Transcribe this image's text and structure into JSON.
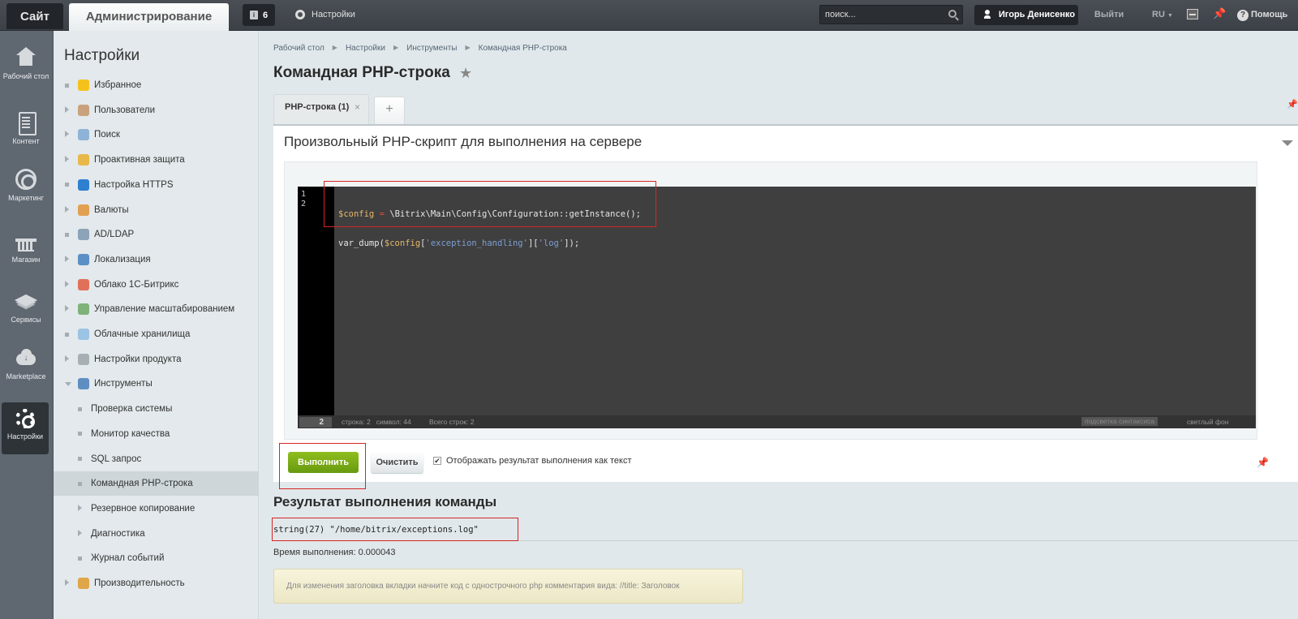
{
  "topbar": {
    "site_label": "Сайт",
    "admin_label": "Администрирование",
    "notifications_count": "6",
    "settings_label": "Настройки",
    "search_placeholder": "поиск...",
    "user_name": "Игорь Денисенко",
    "logout_label": "Выйти",
    "language": "RU",
    "help_label": "Помощь"
  },
  "leftnav": {
    "items": [
      {
        "label": "Рабочий стол",
        "icon": "home-icon"
      },
      {
        "label": "Контент",
        "icon": "document-icon"
      },
      {
        "label": "Маркетинг",
        "icon": "target-icon"
      },
      {
        "label": "Магазин",
        "icon": "basket-icon"
      },
      {
        "label": "Сервисы",
        "icon": "layers-icon"
      },
      {
        "label": "Marketplace",
        "icon": "cloud-download-icon"
      },
      {
        "label": "Настройки",
        "icon": "gear-icon",
        "active": true
      }
    ]
  },
  "sidemenu": {
    "title": "Настройки",
    "items": [
      {
        "label": "Избранное",
        "icon": "star-icon",
        "expandable": false
      },
      {
        "label": "Пользователи",
        "icon": "user-icon",
        "expandable": true
      },
      {
        "label": "Поиск",
        "icon": "magnifier-icon",
        "expandable": true
      },
      {
        "label": "Проактивная защита",
        "icon": "lock-icon",
        "expandable": true
      },
      {
        "label": "Настройка HTTPS",
        "icon": "https-lock-icon",
        "expandable": false
      },
      {
        "label": "Валюты",
        "icon": "currency-icon",
        "expandable": true
      },
      {
        "label": "AD/LDAP",
        "icon": "ldap-icon",
        "expandable": false
      },
      {
        "label": "Локализация",
        "icon": "globe-icon",
        "expandable": true
      },
      {
        "label": "Облако 1С-Битрикс",
        "icon": "bitrix-cloud-icon",
        "expandable": true
      },
      {
        "label": "Управление масштабированием",
        "icon": "server-icon",
        "expandable": true
      },
      {
        "label": "Облачные хранилища",
        "icon": "cloud-storage-icon",
        "expandable": false
      },
      {
        "label": "Настройки продукта",
        "icon": "gear-icon",
        "expandable": true
      },
      {
        "label": "Инструменты",
        "icon": "tools-icon",
        "expandable": true,
        "open": true
      },
      {
        "label": "Проверка системы",
        "sub": true
      },
      {
        "label": "Монитор качества",
        "sub": true
      },
      {
        "label": "SQL запрос",
        "sub": true
      },
      {
        "label": "Командная PHP-строка",
        "sub": true,
        "active": true
      },
      {
        "label": "Резервное копирование",
        "sub": true,
        "expandable": true
      },
      {
        "label": "Диагностика",
        "sub": true,
        "expandable": true
      },
      {
        "label": "Журнал событий",
        "sub": true
      },
      {
        "label": "Производительность",
        "icon": "gauge-icon",
        "expandable": true
      }
    ]
  },
  "breadcrumb": [
    "Рабочий стол",
    "Настройки",
    "Инструменты",
    "Командная PHP-строка"
  ],
  "page_title": "Командная PHP-строка",
  "tabs": {
    "active_label": "PHP-строка (1)",
    "add_label": "+"
  },
  "panel": {
    "title": "Произвольный PHP-скрипт для выполнения на сервере",
    "code_lines": [
      "$config = \\Bitrix\\Main\\Config\\Configuration::getInstance();",
      "var_dump($config['exception_handling']['log']);"
    ],
    "line_numbers": [
      "1",
      "2"
    ],
    "status": {
      "current_line": "2",
      "position": "строка: 2   символ: 44",
      "total": "Всего строк: 2",
      "syntax_highlight": "подсветка синтаксиса",
      "light_bg": "светлый фон"
    }
  },
  "actions": {
    "run_label": "Выполнить",
    "clear_label": "Очистить",
    "show_as_text_label": "Отображать результат выполнения как текст",
    "show_as_text_checked": true
  },
  "result": {
    "title": "Результат выполнения команды",
    "output": "string(27) \"/home/bitrix/exceptions.log\"",
    "exec_time": "Время выполнения: 0.000043",
    "hint": "Для изменения заголовка вкладки начните код с однострочного php комментария вида: //title: Заголовок"
  },
  "colors": {
    "accent_green": "#7aab16",
    "highlight_red": "#d62424",
    "topbar": "#43484e",
    "leftnav": "#5f6770"
  }
}
